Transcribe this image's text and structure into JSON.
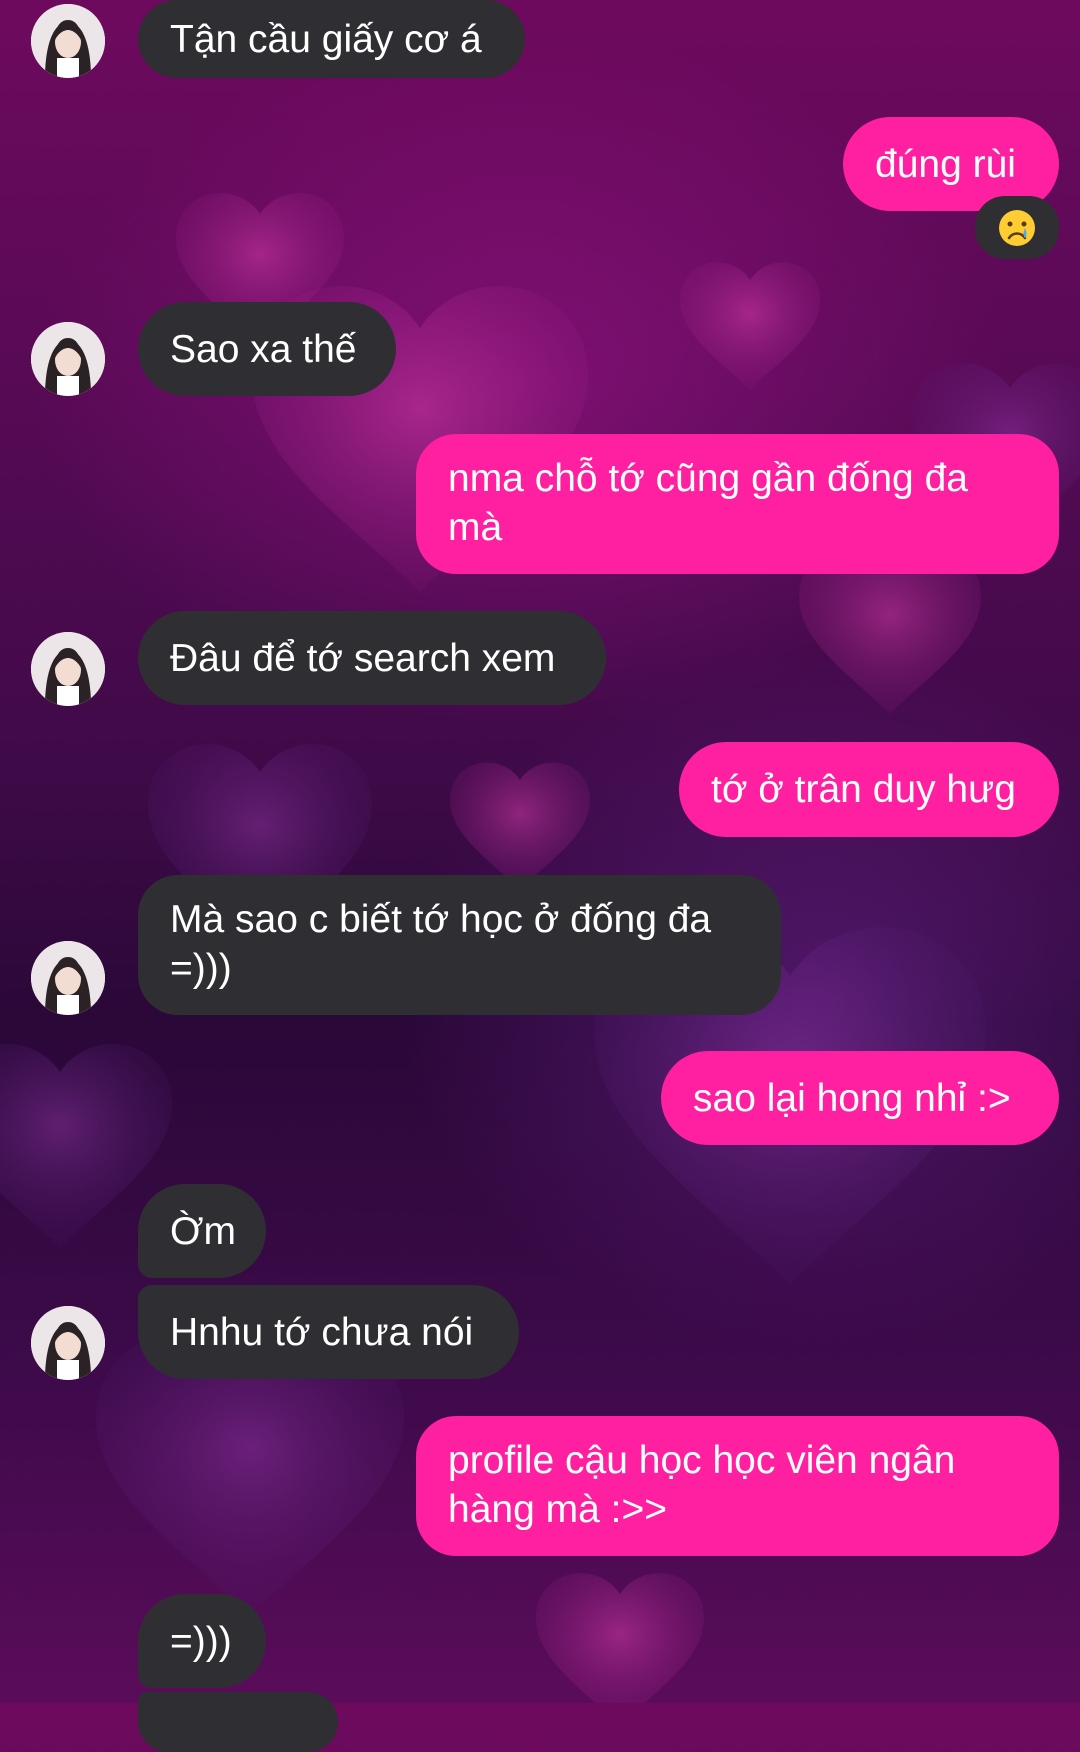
{
  "messages": [
    {
      "text": "Tận cầu giấy cơ á"
    },
    {
      "text": "đúng rùi",
      "reaction": "crying-face-emoji"
    },
    {
      "text": "Sao xa thế"
    },
    {
      "text": "nma chỗ tớ cũng gần đống đa mà"
    },
    {
      "text": "Đâu để tớ search xem"
    },
    {
      "text": "tớ ở trân duy hưg"
    },
    {
      "text": "Mà sao c biết tớ học ở đống đa =)))"
    },
    {
      "text": "sao lại hong nhỉ :>"
    },
    {
      "text": "Ờm"
    },
    {
      "text": "Hnhu tớ chưa nói"
    },
    {
      "text": "profile cậu học học viên ngân hàng mà :>>"
    },
    {
      "text": "=)))"
    }
  ],
  "colors": {
    "incoming_bubble": "#2f2f33",
    "outgoing_bubble": "#ff1fa1",
    "background_top": "#6e0a5e",
    "background_bottom": "#5a0c5a"
  }
}
